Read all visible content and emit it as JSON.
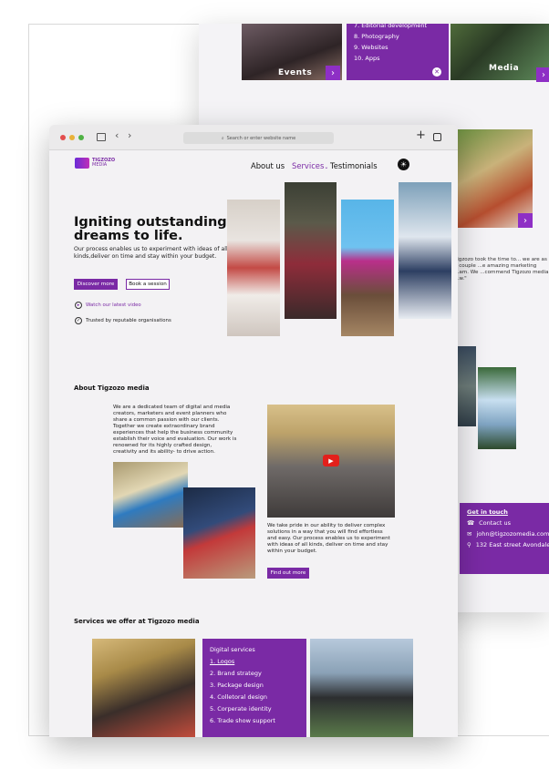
{
  "back_window": {
    "tiles": {
      "events_label": "Events",
      "media_label": "Media"
    },
    "services_list": [
      "7. Editorial development",
      "8. Photography",
      "9. Websites",
      "10. Apps"
    ],
    "testimonial_text": "Tigzozo took the time to... we are as a couple ...e amazing marketing ...am. We ...commend Tigzozo media ...w.\"",
    "contact": {
      "title": "Get in touch",
      "items": [
        {
          "icon": "phone-icon",
          "text": "Contact us"
        },
        {
          "icon": "mail-icon",
          "text": "john@tigzozomedia.com"
        },
        {
          "icon": "pin-icon",
          "text": "132 East street Avondale,"
        }
      ]
    }
  },
  "browser": {
    "address_placeholder": "Search or enter website name"
  },
  "site": {
    "brand": {
      "line1": "TIGZOZO",
      "line2": "MEDIA"
    },
    "nav": {
      "about": "About us",
      "services": "Services",
      "testimonials": "Testimonials"
    },
    "hero": {
      "title": "Igniting outstanding dreams to life.",
      "subtitle": "Our process enables us to experiment with ideas of all kinds,deliver on time and stay within your budget.",
      "discover_label": "Discover more",
      "book_label": "Book a session",
      "watch_label": "Watch our latest video",
      "trusted_label": "Trusted by reputable organisations"
    },
    "about": {
      "title": "About Tigzozo media",
      "intro": "We are a dedicated team of digital and media creators, marketers and event planners who share a common passion with our clients. Together we create extraordinary brand experiences that help the business community establish their voice and evaluation. Our work is renowned for its highly crafted design, creativity and its ability- to drive action.",
      "body": "We take pride in our ability to deliver complex solutions in a way that you will find effortless and easy. Our process enables us to experiment with ideas of all kinds, deliver on time and stay within your budget.",
      "find_out_label": "Find out more"
    },
    "services": {
      "title": "Services we offer at Tigzozo media",
      "panel_title": "Digital services",
      "items": [
        "1. Logos",
        "2. Brand strategy",
        "3. Package design",
        "4. Colletoral design",
        "5. Corperate identity",
        "6. Trade show support"
      ]
    }
  },
  "colors": {
    "brand_purple": "#7a2aa5",
    "accent_violet": "#8e2fc5"
  }
}
